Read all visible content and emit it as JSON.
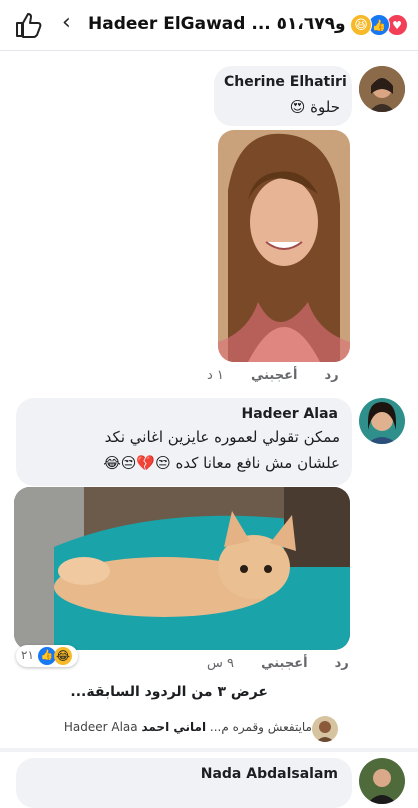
{
  "header": {
    "title": "Hadeer ElGawad ... من",
    "count": "و٥١،٦٧٩",
    "reactions": [
      "like-icon",
      "love-icon",
      "haha-icon"
    ]
  },
  "comments": [
    {
      "author": "Cherine Elhatiri",
      "text": "حلوة",
      "emoji": "😍",
      "time": "١ د",
      "like_label": "أعجبني",
      "reply_label": "رد"
    },
    {
      "author": "Hadeer Alaa",
      "line1": "ممكن تقولي لعموره عايزين اغاني نكد",
      "line2": "علشان مش نافع معانا كده",
      "emoji_line2": "😒💔😒😂",
      "time": "٩ س",
      "like_label": "أعجبني",
      "reply_label": "رد",
      "reaction_count": "٢١"
    }
  ],
  "view_more": "عرض ٣ من الردود السابقة...",
  "reply_preview": {
    "author": "اماني احمد",
    "text": "مايتفعش وقمره م...",
    "mention": "Hadeer Alaa"
  },
  "last_comment": {
    "author": "Nada Abdalsalam"
  }
}
